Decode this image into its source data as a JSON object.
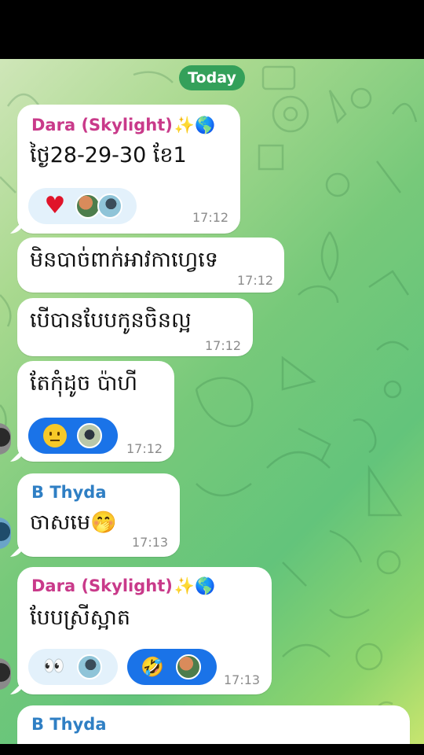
{
  "date_separator": "Today",
  "messages": [
    {
      "sender": "Dara (Skylight)",
      "sender_emojis": "✨🌎",
      "text": "ថ្ងៃ28-29-30 ខែ1",
      "time": "17:12",
      "reactions": [
        {
          "emoji": "❤️",
          "active": false
        }
      ]
    },
    {
      "text": "មិនបាច់ពាក់អាវកាហ្វេទេ",
      "time": "17:12"
    },
    {
      "text": "បើបានបែបកូនចិនល្អ",
      "time": "17:12"
    },
    {
      "text": "តែកុំដូច ប៉ាហី",
      "time": "17:12",
      "reactions": [
        {
          "emoji": "😐",
          "active": true
        }
      ]
    },
    {
      "sender": "B Thyda",
      "text": "ចាសមេ",
      "text_emoji": "🤭",
      "time": "17:13"
    },
    {
      "sender": "Dara (Skylight)",
      "sender_emojis": "✨🌎",
      "text": "បែបស្រីស្អាត",
      "time": "17:13",
      "reactions": [
        {
          "emoji": "👀",
          "active": false
        },
        {
          "emoji": "🤣",
          "active": true
        }
      ]
    },
    {
      "sender": "B Thyda"
    }
  ],
  "colors": {
    "date_pill": "#34a05a",
    "sender_pink": "#c93a8a",
    "sender_blue": "#2f7fc4",
    "reaction_active": "#1a73e8",
    "reaction_idle": "#e3f1fb"
  }
}
